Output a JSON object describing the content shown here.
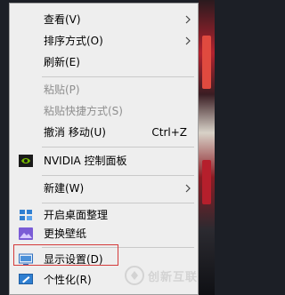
{
  "menu": {
    "items": [
      {
        "label": "查看(V)",
        "submenu": true
      },
      {
        "label": "排序方式(O)",
        "submenu": true
      },
      {
        "label": "刷新(E)"
      },
      {
        "label": "粘贴(P)",
        "disabled": true
      },
      {
        "label": "粘贴快捷方式(S)",
        "disabled": true
      },
      {
        "label": "撤消 移动(U)",
        "shortcut": "Ctrl+Z"
      },
      {
        "label": "NVIDIA 控制面板",
        "icon": "nvidia-icon"
      },
      {
        "label": "新建(W)",
        "submenu": true
      },
      {
        "label": "开启桌面整理",
        "icon": "desktop-organizer-icon"
      },
      {
        "label": "更换壁纸",
        "icon": "wallpaper-icon"
      },
      {
        "label": "显示设置(D)",
        "icon": "display-settings-icon",
        "highlighted": true
      },
      {
        "label": "个性化(R)",
        "icon": "personalize-icon"
      }
    ]
  },
  "watermark": {
    "text": "创新互联",
    "icon": "watermark-logo-icon"
  }
}
